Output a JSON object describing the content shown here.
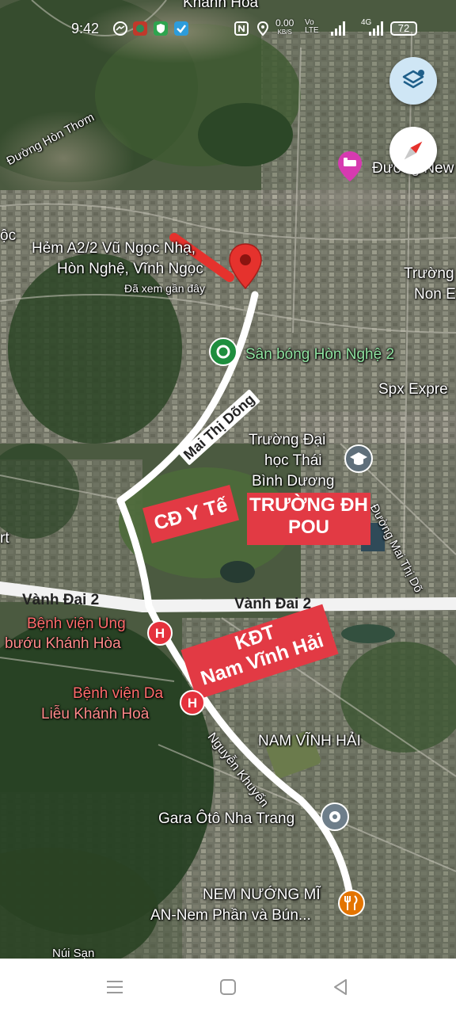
{
  "status_bar": {
    "time": "9:42",
    "net_speed_value": "0.00",
    "net_speed_unit": "KB/S",
    "lte_label": "Vo LTE",
    "network_type": "4G",
    "battery_level": "72"
  },
  "map": {
    "place_labels": [
      {
        "id": "loc",
        "text": "ộc"
      },
      {
        "id": "duong-hon-thom",
        "text": "Đường Hòn Thơm"
      },
      {
        "id": "khanh-hoa-top",
        "text": "Khánh Hòa"
      },
      {
        "id": "duong-new",
        "text": "Đường New"
      },
      {
        "id": "truong-non",
        "text": "Trường"
      },
      {
        "id": "truong-non-2",
        "text": "Non E"
      },
      {
        "id": "spx-express",
        "text": "Spx Expre"
      },
      {
        "id": "truong-dai-hoc-1",
        "text": "Trường Đại"
      },
      {
        "id": "truong-dai-hoc-2",
        "text": "học Thái"
      },
      {
        "id": "truong-dai-hoc-3",
        "text": "Bình Dương"
      },
      {
        "id": "rt",
        "text": "rt"
      },
      {
        "id": "benh-vien-ung-buou-1",
        "text": "Bệnh viện Ung"
      },
      {
        "id": "benh-vien-ung-buou-2",
        "text": "bướu Khánh Hòa"
      },
      {
        "id": "benh-vien-da-lieu-1",
        "text": "Bệnh viện Da"
      },
      {
        "id": "benh-vien-da-lieu-2",
        "text": "Liễu Khánh Hoà"
      },
      {
        "id": "nam-vinh-hai",
        "text": "NAM VĨNH HẢI"
      },
      {
        "id": "gara",
        "text": "Gara Ôtô Nha Trang"
      },
      {
        "id": "nem-nuong-1",
        "text": "NEM NƯỚNG MĨ"
      },
      {
        "id": "nem-nuong-2",
        "text": "AN-Nem Phần và Bún..."
      },
      {
        "id": "nui-san",
        "text": "Núi Sạn"
      }
    ],
    "san_bong": "Sân bóng Hòn Nghệ 2",
    "selected_place": {
      "line1": "Hẻm A2/2 Vũ Ngọc Nhạ,",
      "line2": "Hòn Nghệ, Vĩnh Ngọc",
      "recent": "Đã xem gần đây"
    },
    "roads": {
      "mai_thi_dong": "Mai Thị Dõng",
      "duong_mai_thi_dong": "Đường Mai Thị Dõ",
      "vanh_dai_2_left": "Vành Đai 2",
      "vanh_dai_2_right": "Vành Đai 2",
      "nguyen_khuyen": "Nguyễn Khuyến"
    },
    "banners": {
      "cd_y_te": "CĐ Y Tế",
      "truong_dh_1": "TRƯỜNG ĐH",
      "truong_dh_2": "POU",
      "kdt_1": "KĐT",
      "kdt_2": "Nam Vĩnh Hải"
    },
    "icons": [
      "layers-icon",
      "compass-icon",
      "hotel-pin-icon",
      "red-location-pin-icon",
      "stadium-pin-icon",
      "school-pin-icon",
      "hospital-pin-icon",
      "car-service-pin-icon",
      "restaurant-pin-icon"
    ]
  },
  "colors": {
    "banner_red": "#e23a44",
    "route_white": "#ffffff",
    "pin_red": "#e5322d",
    "pin_green": "#1e8e3e",
    "pin_pink": "#d63ab0",
    "pin_orange": "#e37400"
  },
  "nav_bar": {
    "icons": [
      "menu-icon",
      "home-icon",
      "back-icon"
    ]
  }
}
